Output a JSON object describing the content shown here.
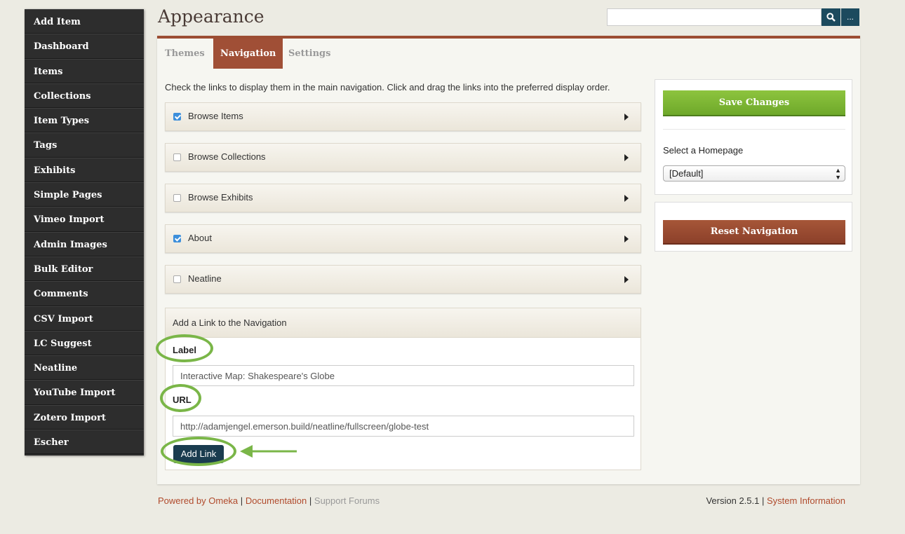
{
  "sidebar": {
    "items": [
      {
        "label": "Add Item"
      },
      {
        "label": "Dashboard"
      },
      {
        "label": "Items"
      },
      {
        "label": "Collections"
      },
      {
        "label": "Item Types"
      },
      {
        "label": "Tags"
      },
      {
        "label": "Exhibits"
      },
      {
        "label": "Simple Pages"
      },
      {
        "label": "Vimeo Import"
      },
      {
        "label": "Admin Images"
      },
      {
        "label": "Bulk Editor"
      },
      {
        "label": "Comments"
      },
      {
        "label": "CSV Import"
      },
      {
        "label": "LC Suggest"
      },
      {
        "label": "Neatline"
      },
      {
        "label": "YouTube Import"
      },
      {
        "label": "Zotero Import"
      },
      {
        "label": "Escher"
      }
    ]
  },
  "header": {
    "title": "Appearance",
    "search": {
      "value": "",
      "more_label": "..."
    }
  },
  "tabs": [
    {
      "label": "Themes",
      "active": false
    },
    {
      "label": "Navigation",
      "active": true
    },
    {
      "label": "Settings",
      "active": false
    }
  ],
  "main": {
    "instructions": "Check the links to display them in the main navigation. Click and drag the links into the preferred display order.",
    "nav_links": [
      {
        "label": "Browse Items",
        "checked": true
      },
      {
        "label": "Browse Collections",
        "checked": false
      },
      {
        "label": "Browse Exhibits",
        "checked": false
      },
      {
        "label": "About",
        "checked": true
      },
      {
        "label": "Neatline",
        "checked": false
      }
    ],
    "add_link": {
      "header": "Add a Link to the Navigation",
      "label_field": {
        "label": "Label",
        "value": "Interactive Map: Shakespeare's Globe"
      },
      "url_field": {
        "label": "URL",
        "value": "http://adamjengel.emerson.build/neatline/fullscreen/globe-test"
      },
      "button_label": "Add Link"
    }
  },
  "right_panel": {
    "save_label": "Save Changes",
    "homepage_label": "Select a Homepage",
    "homepage_value": "[Default]",
    "reset_label": "Reset Navigation"
  },
  "footer": {
    "powered_by": "Powered by Omeka",
    "documentation": "Documentation",
    "support_forums": "Support Forums",
    "version": "Version 2.5.1",
    "system_info": "System Information",
    "separator": "|"
  },
  "colors": {
    "accent": "#a04f36",
    "save_green": "#7ab432",
    "highlight_green": "#7ab648",
    "sidebar_bg": "#2d2d2d",
    "search_btn": "#1c4a5e"
  }
}
